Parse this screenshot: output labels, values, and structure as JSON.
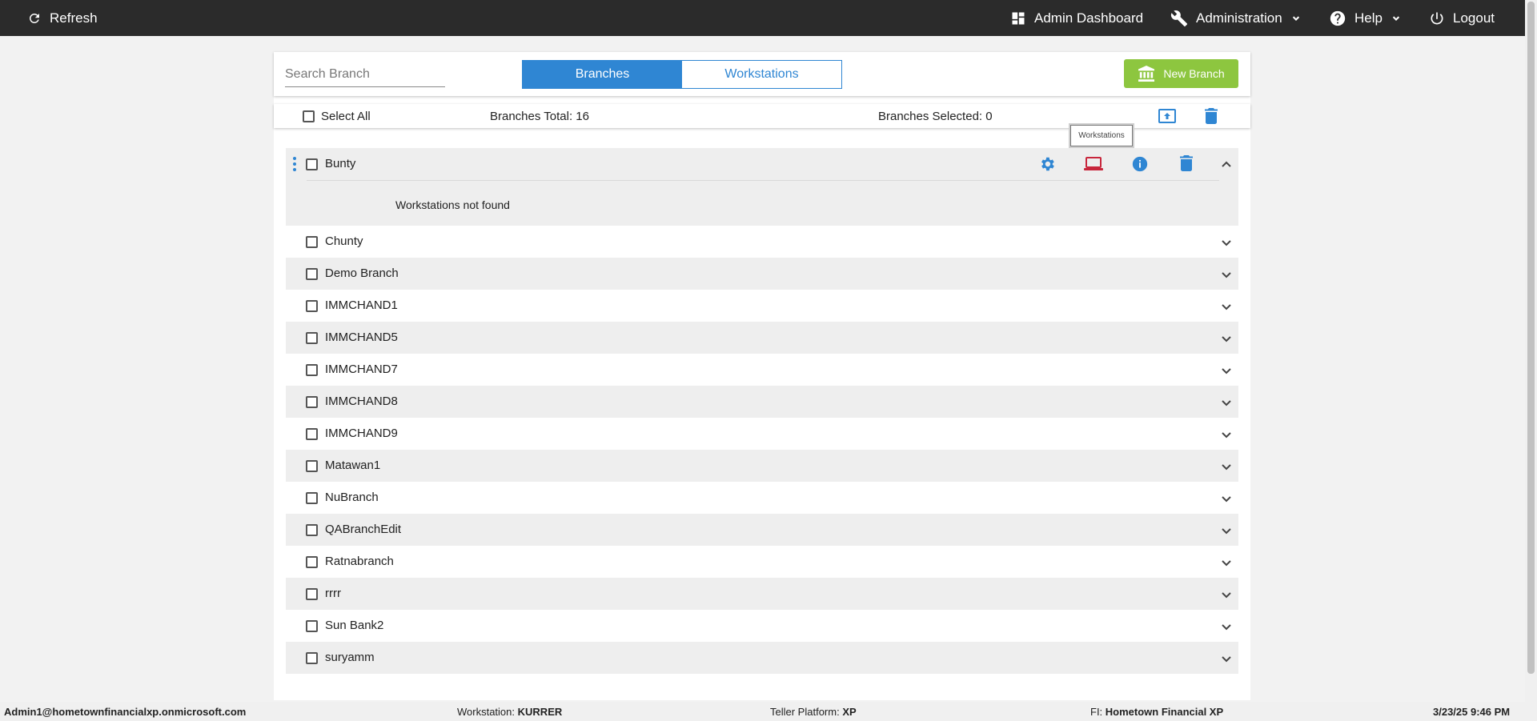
{
  "topbar": {
    "refresh_label": "Refresh",
    "admin_dashboard_label": "Admin Dashboard",
    "administration_label": "Administration",
    "help_label": "Help",
    "logout_label": "Logout"
  },
  "toolbar": {
    "search_placeholder": "Search Branch",
    "tabs": [
      {
        "label": "Branches",
        "active": true
      },
      {
        "label": "Workstations",
        "active": false
      }
    ],
    "new_branch_label": "New Branch",
    "new_branch_icon": "bank-icon"
  },
  "selection": {
    "select_all_label": "Select All",
    "total_label": "Branches Total: 16",
    "selected_label": "Branches Selected: 0"
  },
  "tooltip": "Workstations",
  "expanded_branch": {
    "name": "Bunty",
    "message": "Workstations not found",
    "actions": [
      "settings-icon",
      "laptop-icon",
      "info-icon",
      "delete-icon"
    ]
  },
  "branches": [
    "Chunty",
    "Demo Branch",
    "IMMCHAND1",
    "IMMCHAND5",
    "IMMCHAND7",
    "IMMCHAND8",
    "IMMCHAND9",
    "Matawan1",
    "NuBranch",
    "QABranchEdit",
    "Ratnabranch",
    "rrrr",
    "Sun Bank2",
    "suryamm"
  ],
  "footer": {
    "user": "Admin1@hometownfinancialxp.onmicrosoft.com",
    "workstation_label": "Workstation:",
    "workstation_value": "KURRER",
    "platform_label": "Teller Platform:",
    "platform_value": "XP",
    "fi_label": "FI:",
    "fi_value": "Hometown Financial XP",
    "datetime": "3/23/25 9:46 PM"
  },
  "colors": {
    "topbar": "#2b2b2b",
    "accent_blue": "#2f86d3",
    "new_button_green": "#8dc63f",
    "laptop_icon_red": "#c8263c"
  }
}
